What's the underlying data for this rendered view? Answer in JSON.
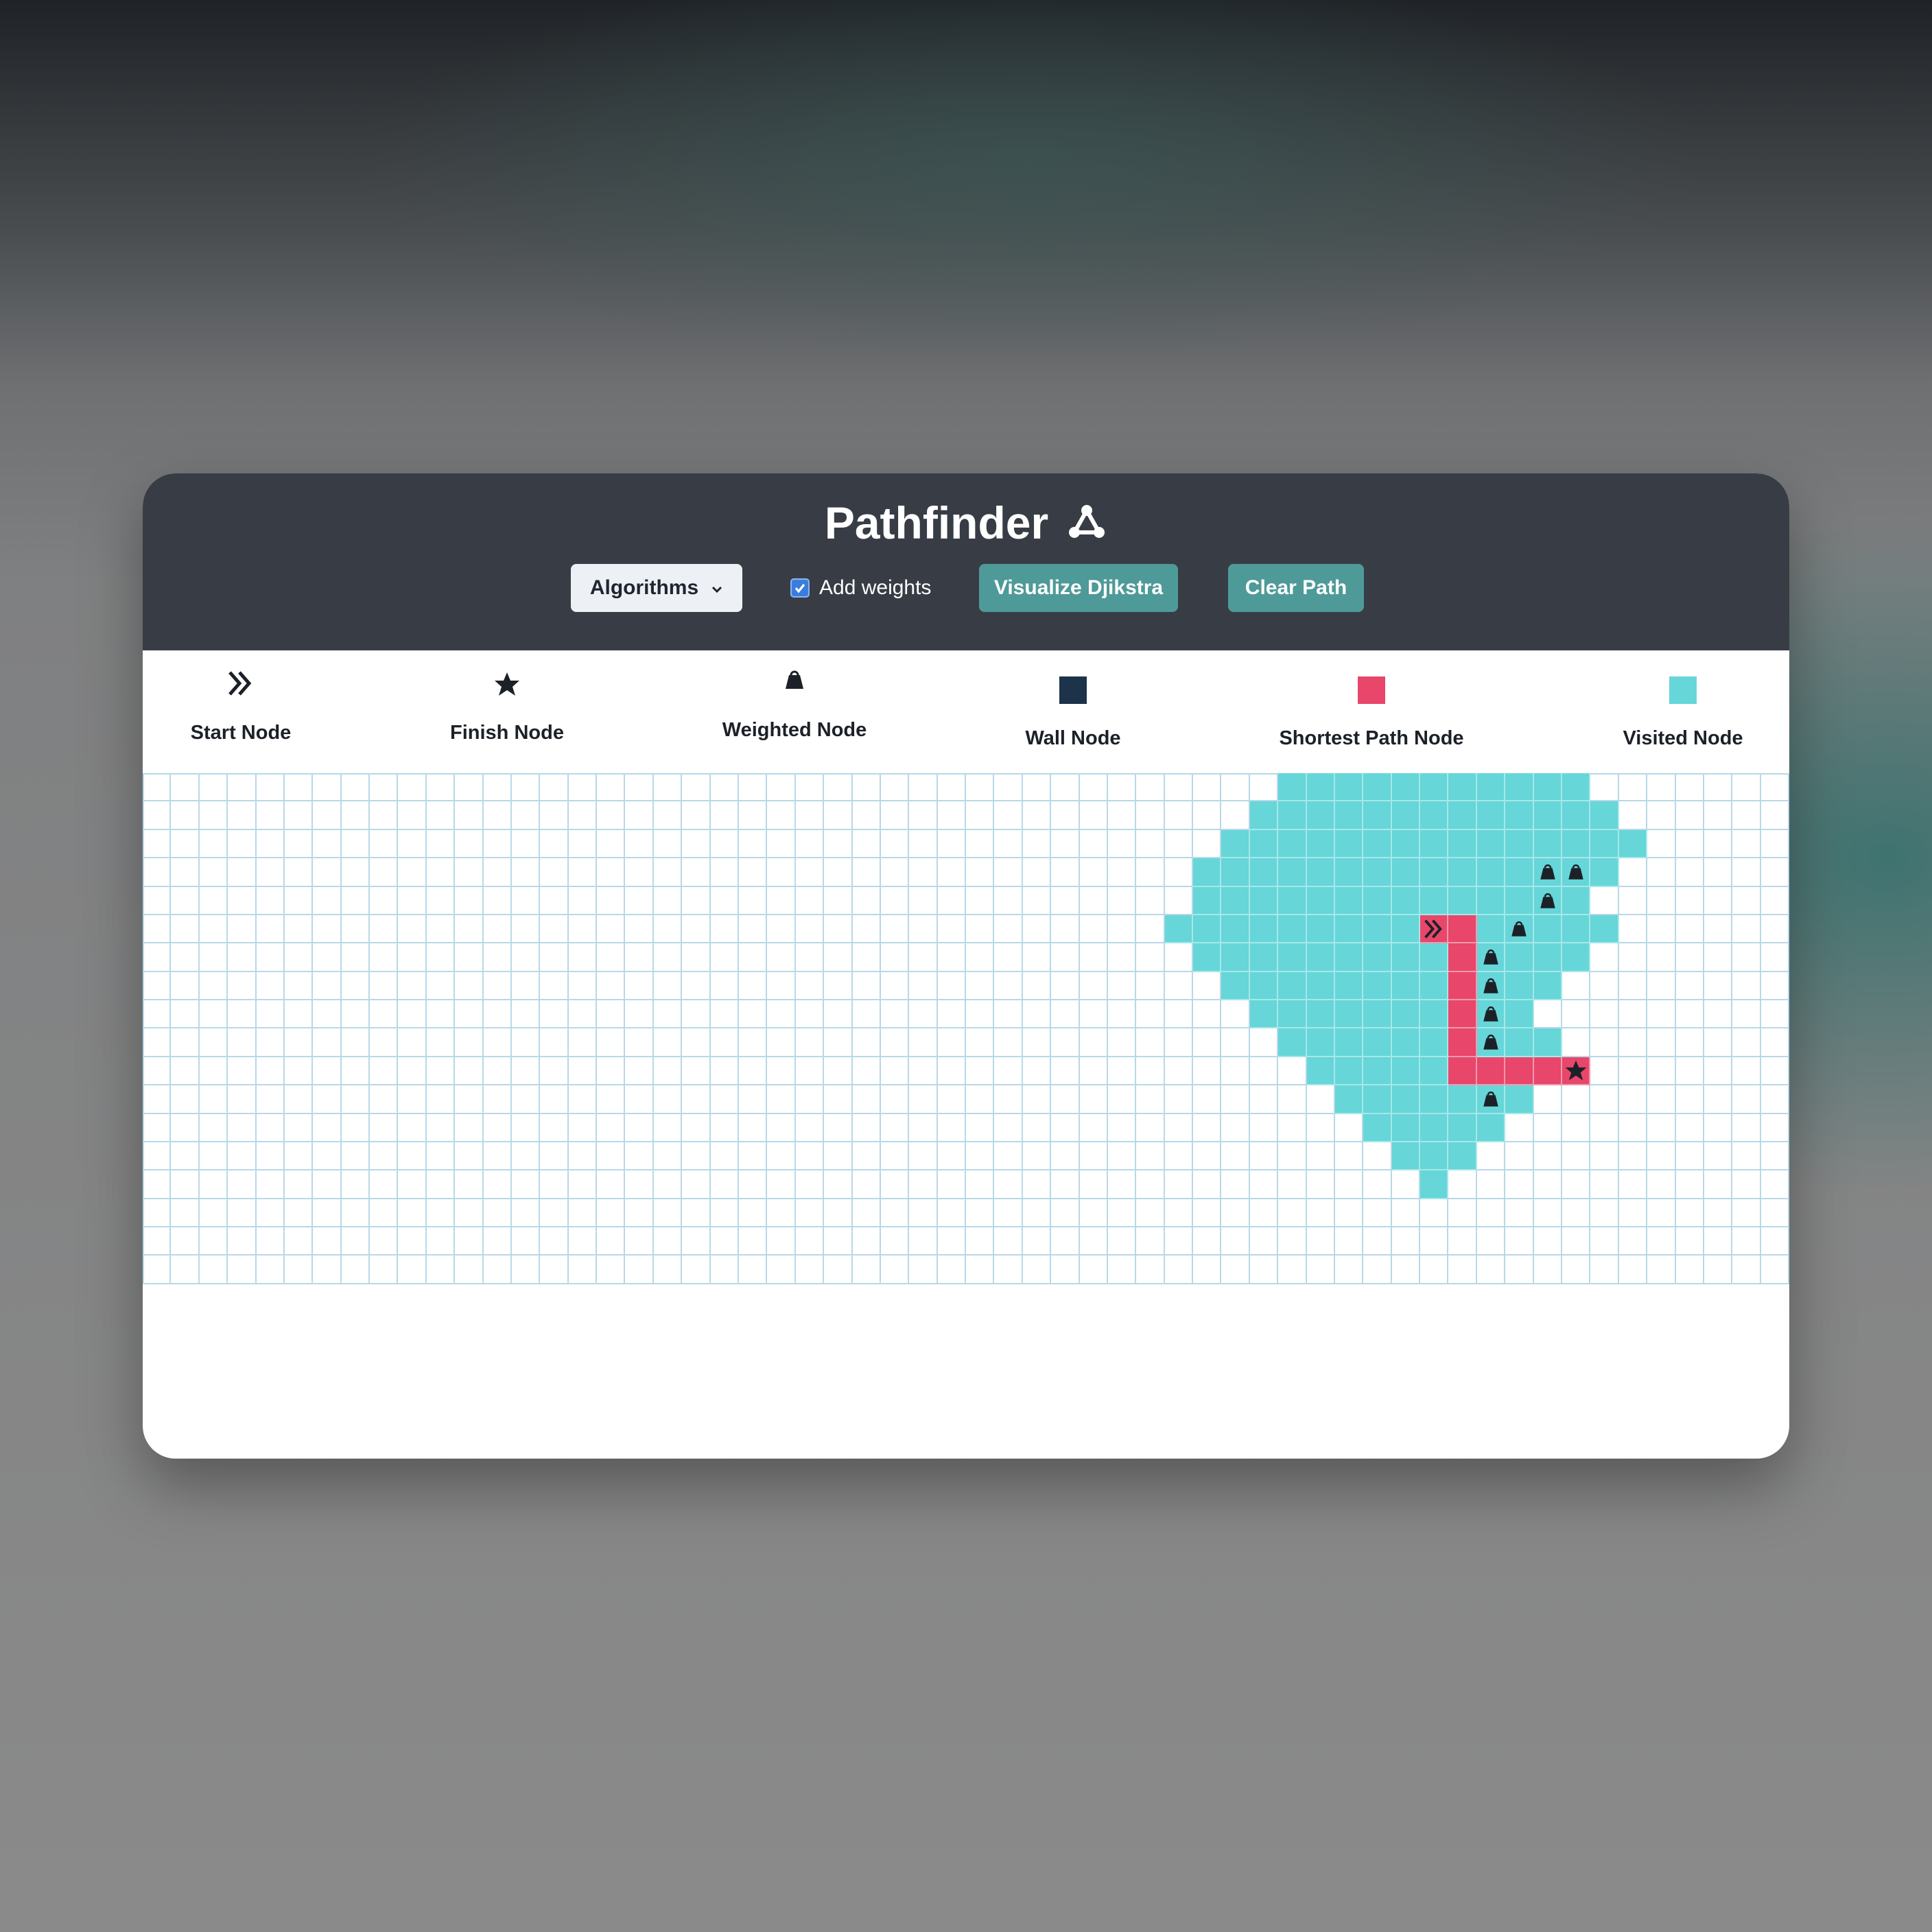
{
  "app": {
    "title": "Pathfinder",
    "logo_icon": "graph-nodes-icon"
  },
  "toolbar": {
    "algorithms_label": "Algorithms",
    "algorithms_icon": "chevron-down-icon",
    "add_weights_label": "Add weights",
    "add_weights_checked": true,
    "visualize_label": "Visualize Djikstra",
    "clear_label": "Clear Path"
  },
  "legend": {
    "items": [
      {
        "label": "Start Node",
        "icon": "double-chevron-right-icon"
      },
      {
        "label": "Finish Node",
        "icon": "star-icon"
      },
      {
        "label": "Weighted Node",
        "icon": "weight-icon"
      },
      {
        "label": "Wall Node",
        "icon": "square",
        "color": "#1c3349"
      },
      {
        "label": "Shortest Path Node",
        "icon": "square",
        "color": "#e8466a"
      },
      {
        "label": "Visited Node",
        "icon": "square",
        "color": "#66d6d8"
      }
    ]
  },
  "colors": {
    "header_bg": "#383d45",
    "accent": "#4e9a98",
    "visited": "#66d6d8",
    "path": "#e8466a",
    "wall": "#1c3349",
    "grid_line": "#b8d8e8",
    "icon": "#1c2128"
  },
  "grid": {
    "rows": 18,
    "cols": 58,
    "start": [
      5,
      45
    ],
    "finish": [
      10,
      50
    ],
    "visited_ranges": [
      [
        0,
        40,
        50
      ],
      [
        1,
        39,
        51
      ],
      [
        2,
        38,
        52
      ],
      [
        3,
        37,
        51
      ],
      [
        4,
        37,
        50
      ],
      [
        5,
        36,
        51
      ],
      [
        6,
        37,
        50
      ],
      [
        7,
        38,
        49
      ],
      [
        8,
        39,
        48
      ],
      [
        9,
        40,
        49
      ],
      [
        10,
        41,
        50
      ],
      [
        11,
        42,
        48
      ],
      [
        12,
        43,
        47
      ],
      [
        13,
        44,
        46
      ],
      [
        14,
        45,
        45
      ]
    ],
    "path_cells": [
      [
        5,
        45
      ],
      [
        5,
        46
      ],
      [
        6,
        46
      ],
      [
        7,
        46
      ],
      [
        8,
        46
      ],
      [
        9,
        46
      ],
      [
        10,
        46
      ],
      [
        10,
        47
      ],
      [
        10,
        48
      ],
      [
        10,
        49
      ],
      [
        10,
        50
      ]
    ],
    "weight_cells": [
      [
        3,
        49
      ],
      [
        3,
        50
      ],
      [
        4,
        49
      ],
      [
        5,
        48
      ],
      [
        6,
        47
      ],
      [
        7,
        47
      ],
      [
        8,
        47
      ],
      [
        9,
        47
      ],
      [
        11,
        47
      ]
    ]
  }
}
